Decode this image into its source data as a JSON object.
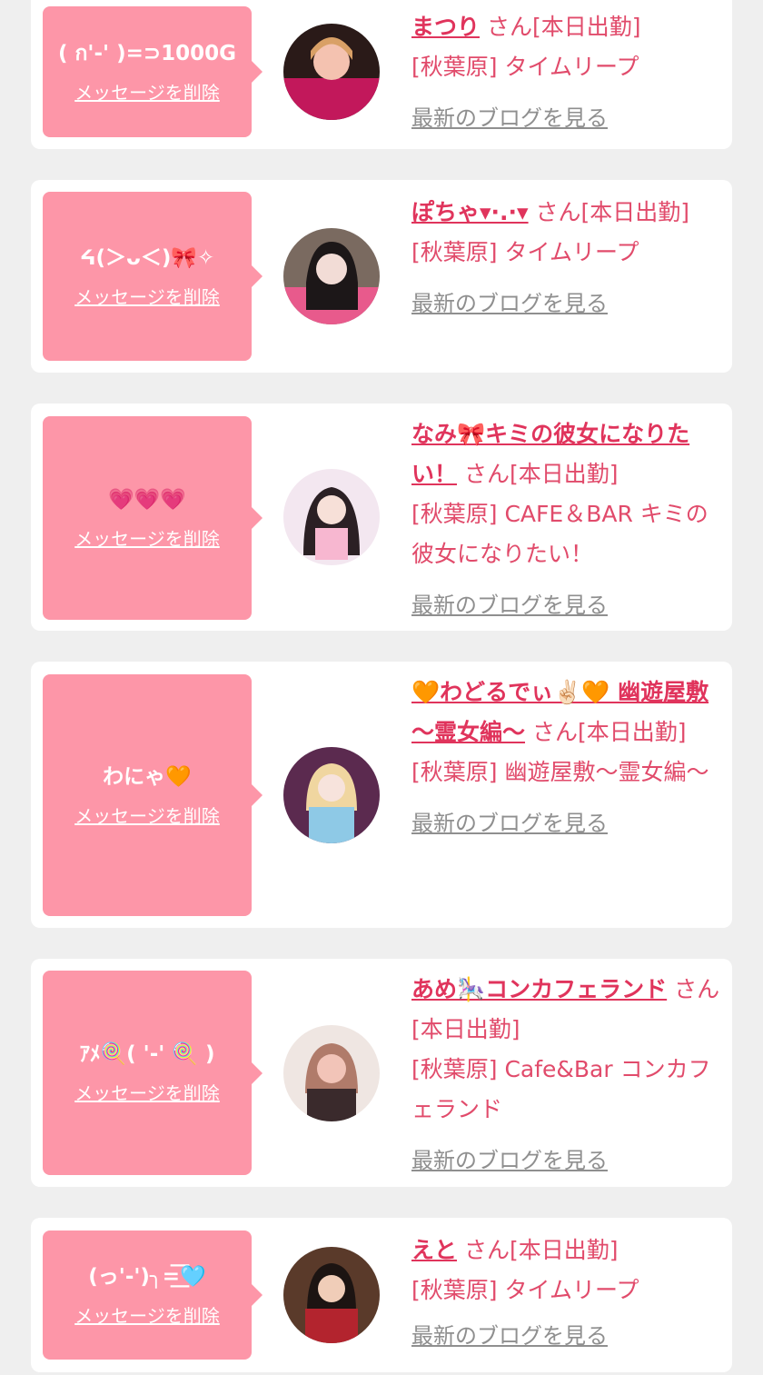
{
  "cards": [
    {
      "message": "( ก'-' )=⊃1000G",
      "delete_label": "メッセージを削除",
      "name": "まつり",
      "suffix": "さん[本日出勤]",
      "shop": "[秋葉原] タイムリープ",
      "blog_label": "最新のブログを見る",
      "avatar_colors": [
        "#2a1a18",
        "#c2185b",
        "#f4c2b0"
      ]
    },
    {
      "message": "ᔦ(＞ᴗ＜)🎀✧",
      "delete_label": "メッセージを削除",
      "name": "ぽちゃ▾·.·▾",
      "suffix": "さん[本日出勤]",
      "shop": "[秋葉原] タイムリープ",
      "blog_label": "最新のブログを見る",
      "avatar_colors": [
        "#3b3536",
        "#e85a8c",
        "#f2dcd6"
      ]
    },
    {
      "message": "💗💗💗",
      "delete_label": "メッセージを削除",
      "name": "なみ🎀キミの彼女になりたい！",
      "suffix": "さん[本日出勤]",
      "shop": "[秋葉原] CAFE＆BAR キミの彼女になりたい！",
      "blog_label": "最新のブログを見る",
      "avatar_colors": [
        "#f3e7f0",
        "#2b2024",
        "#f7b7d0"
      ]
    },
    {
      "message": "わにゃ🧡",
      "delete_label": "メッセージを削除",
      "name": "🧡わどるでぃ✌🏻🧡 幽遊屋敷 〜霊女編〜",
      "suffix": "さん[本日出勤]",
      "shop": "[秋葉原] 幽遊屋敷〜霊女編〜",
      "blog_label": "最新のブログを見る",
      "avatar_colors": [
        "#5b2a4f",
        "#8ec9e6",
        "#f0d6a0"
      ]
    },
    {
      "message": "ｱﾒ🍭( '-' 🍭 )",
      "delete_label": "メッセージを削除",
      "name": "あめ🎠コンカフェランド",
      "suffix": "さん[本日出勤]",
      "shop": "[秋葉原] Cafe&Bar コンカフェランド",
      "blog_label": "最新のブログを見る",
      "avatar_colors": [
        "#efe6e2",
        "#3a2a2c",
        "#f2c4b8"
      ]
    },
    {
      "message": "(っ'-')╮=͟͟͞͞🩵",
      "delete_label": "メッセージを削除",
      "name": "えと",
      "suffix": "さん[本日出勤]",
      "shop": "[秋葉原] タイムリープ",
      "blog_label": "最新のブログを見る",
      "avatar_colors": [
        "#3a2520",
        "#b3242e",
        "#f0cdb8"
      ]
    }
  ]
}
